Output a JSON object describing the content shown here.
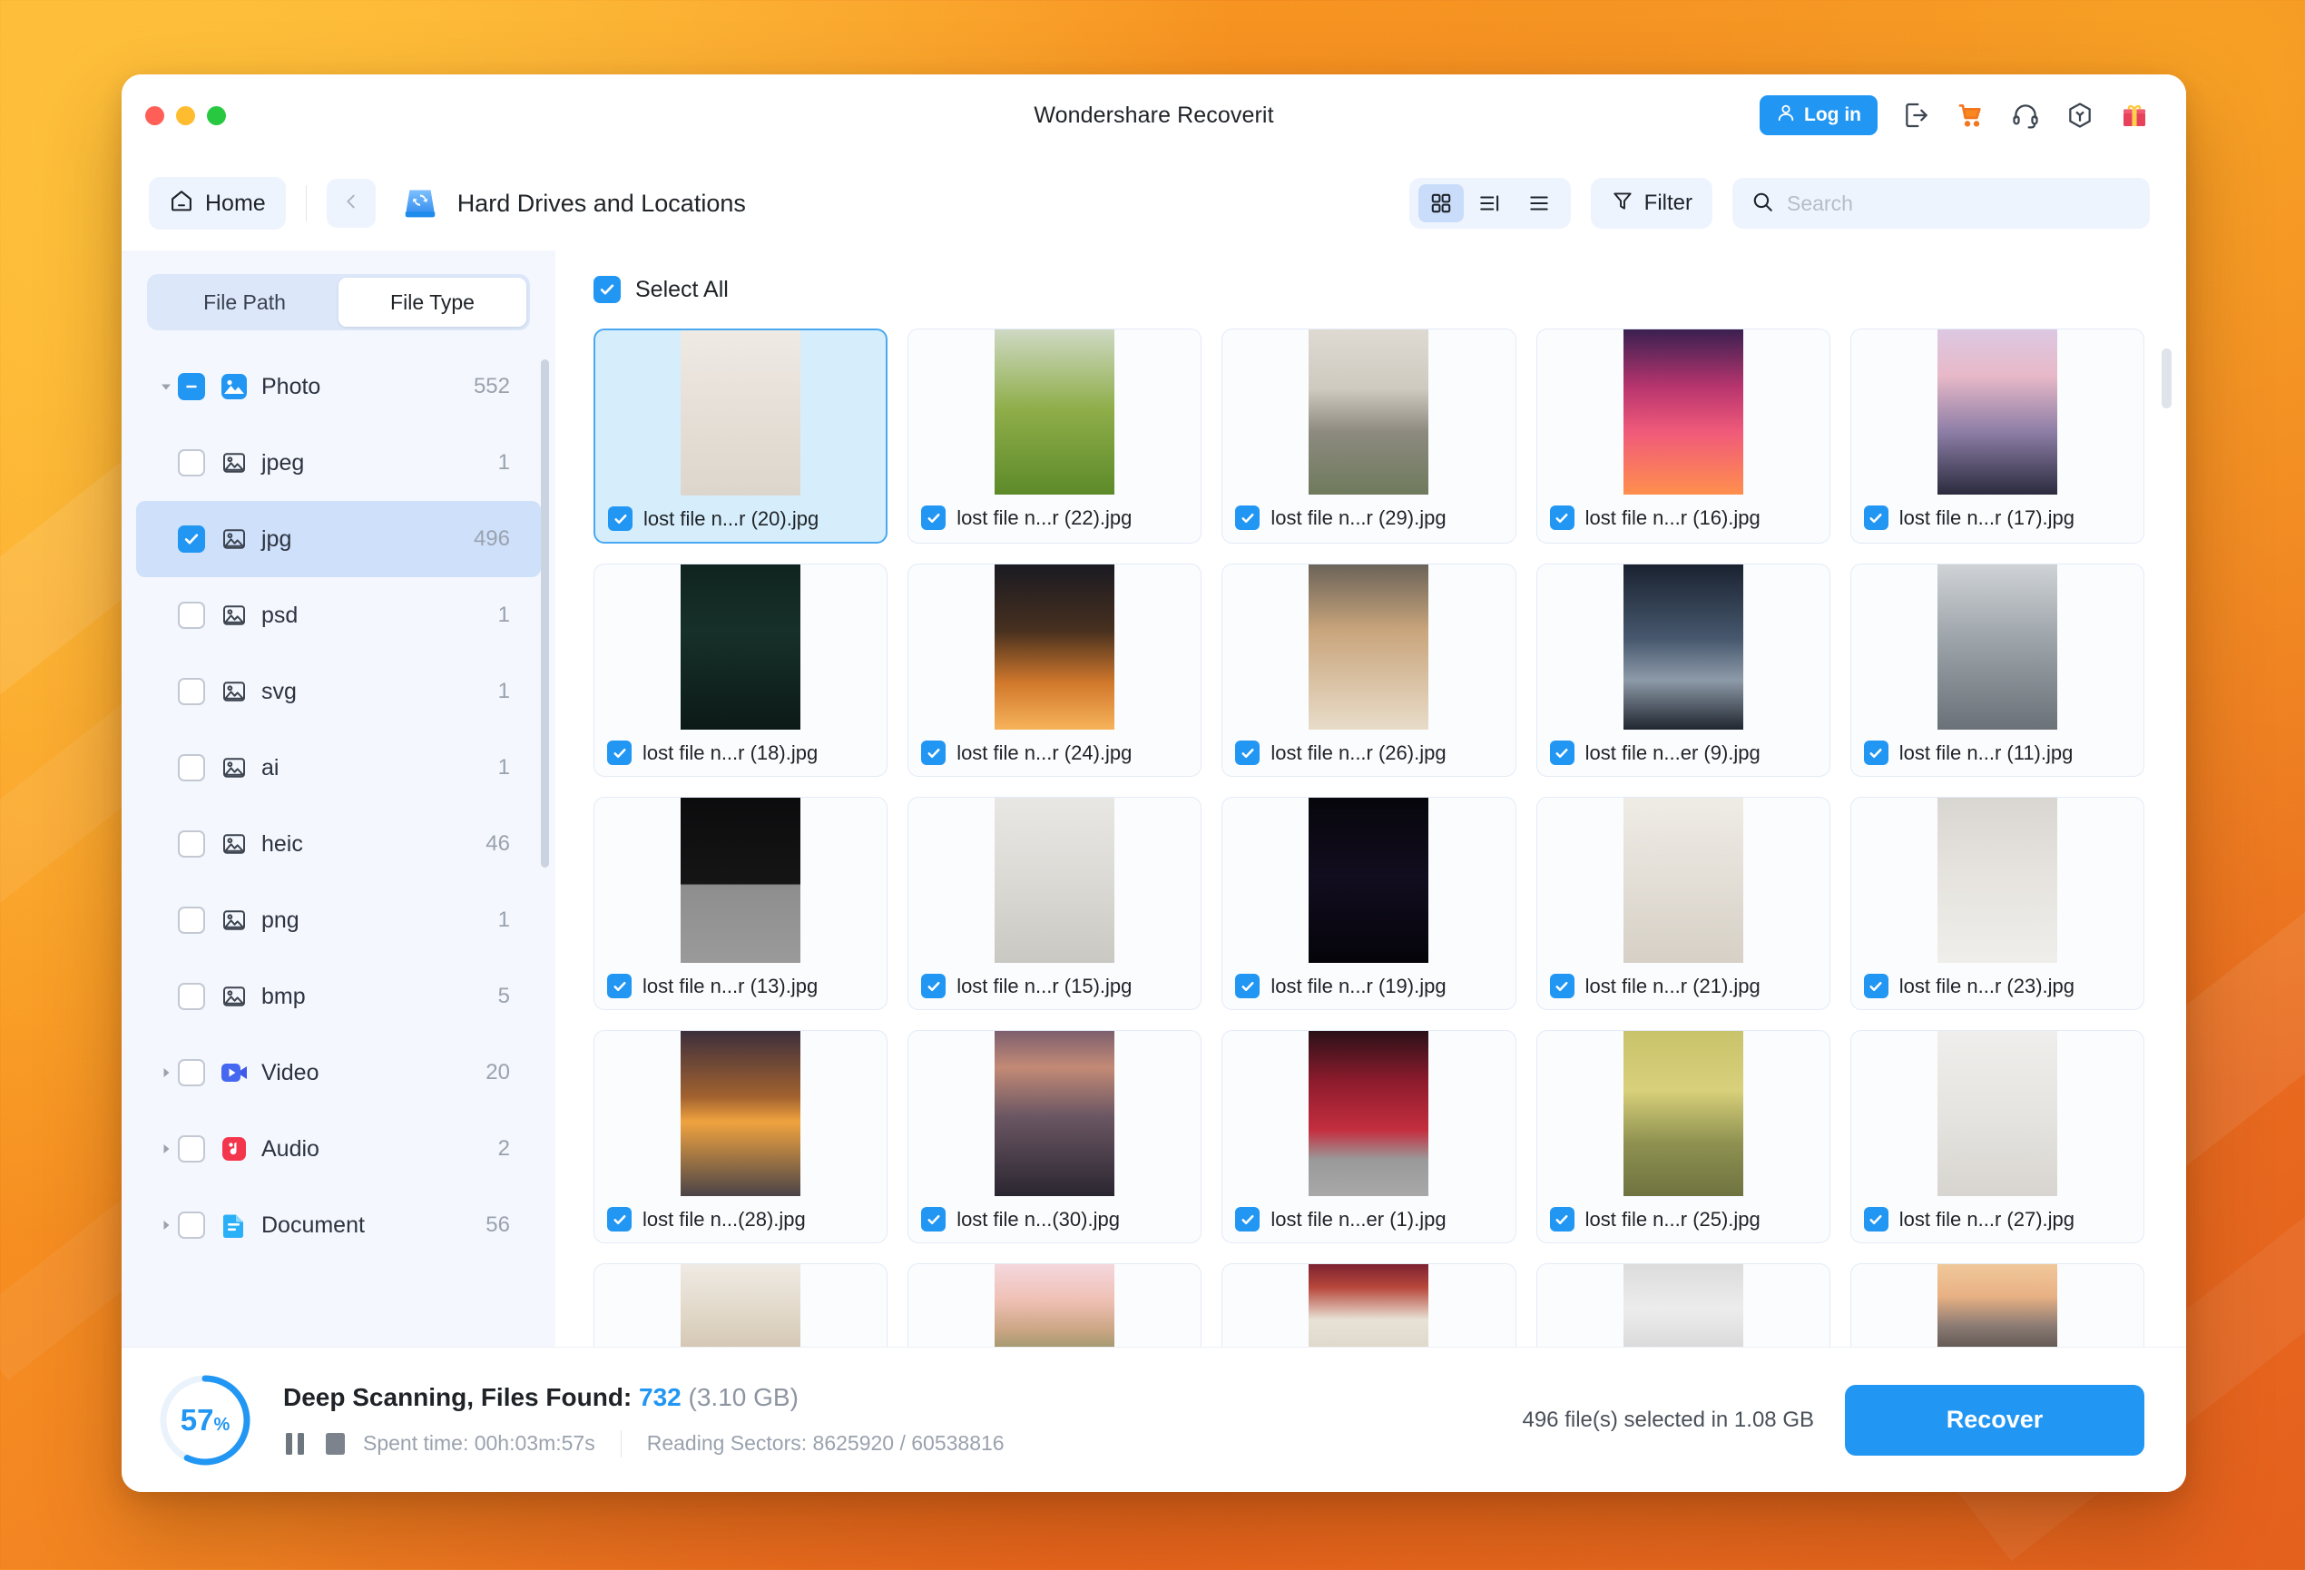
{
  "window": {
    "title": "Wondershare Recoverit",
    "traffic_lights": [
      "close",
      "minimize",
      "maximize"
    ]
  },
  "titlebar": {
    "login_label": "Log in",
    "icons": [
      "user-icon",
      "export-icon",
      "cart-icon",
      "headset-icon",
      "box-icon",
      "gift-icon"
    ]
  },
  "nav": {
    "home_label": "Home",
    "location_title": "Hard Drives and Locations",
    "back_icon": "chevron-left-icon",
    "view_modes": [
      {
        "name": "grid",
        "active": true
      },
      {
        "name": "split-list",
        "active": false
      },
      {
        "name": "list",
        "active": false
      }
    ],
    "filter_label": "Filter",
    "search_placeholder": "Search",
    "search_value": ""
  },
  "sidebar": {
    "tabs": [
      {
        "label": "File Path",
        "active": false
      },
      {
        "label": "File Type",
        "active": true
      }
    ],
    "tree": [
      {
        "label": "Photo",
        "count": "552",
        "check": "indeterminate",
        "icon": "photo-category-icon",
        "caret": "down",
        "level": 0,
        "selected": false
      },
      {
        "label": "jpeg",
        "count": "1",
        "check": "unchecked",
        "icon": "image-file-icon",
        "caret": "none",
        "level": 1,
        "selected": false
      },
      {
        "label": "jpg",
        "count": "496",
        "check": "checked",
        "icon": "image-file-icon",
        "caret": "none",
        "level": 1,
        "selected": true
      },
      {
        "label": "psd",
        "count": "1",
        "check": "unchecked",
        "icon": "image-file-icon",
        "caret": "none",
        "level": 1,
        "selected": false
      },
      {
        "label": "svg",
        "count": "1",
        "check": "unchecked",
        "icon": "image-file-icon",
        "caret": "none",
        "level": 1,
        "selected": false
      },
      {
        "label": "ai",
        "count": "1",
        "check": "unchecked",
        "icon": "image-file-icon",
        "caret": "none",
        "level": 1,
        "selected": false
      },
      {
        "label": "heic",
        "count": "46",
        "check": "unchecked",
        "icon": "image-file-icon",
        "caret": "none",
        "level": 1,
        "selected": false
      },
      {
        "label": "png",
        "count": "1",
        "check": "unchecked",
        "icon": "image-file-icon",
        "caret": "none",
        "level": 1,
        "selected": false
      },
      {
        "label": "bmp",
        "count": "5",
        "check": "unchecked",
        "icon": "image-file-icon",
        "caret": "none",
        "level": 1,
        "selected": false
      },
      {
        "label": "Video",
        "count": "20",
        "check": "unchecked",
        "icon": "video-category-icon",
        "caret": "right",
        "level": 0,
        "selected": false
      },
      {
        "label": "Audio",
        "count": "2",
        "check": "unchecked",
        "icon": "audio-category-icon",
        "caret": "right",
        "level": 0,
        "selected": false
      },
      {
        "label": "Document",
        "count": "56",
        "check": "unchecked",
        "icon": "document-category-icon",
        "caret": "right",
        "level": 0,
        "selected": false
      }
    ]
  },
  "content": {
    "select_all_label": "Select All",
    "select_all_checked": true,
    "files": [
      {
        "name": "lost file n...r (20).jpg",
        "checked": true,
        "selected": true,
        "thumb": "cat-window-calico"
      },
      {
        "name": "lost file n...r (22).jpg",
        "checked": true,
        "selected": false,
        "thumb": "cat-in-leaves"
      },
      {
        "name": "lost file n...r (29).jpg",
        "checked": true,
        "selected": false,
        "thumb": "window-flowers-wall"
      },
      {
        "name": "lost file n...r (16).jpg",
        "checked": true,
        "selected": false,
        "thumb": "neon-pink-interior"
      },
      {
        "name": "lost file n...r (17).jpg",
        "checked": true,
        "selected": false,
        "thumb": "lavender-sunset-field"
      },
      {
        "name": "lost file n...r (18).jpg",
        "checked": true,
        "selected": false,
        "thumb": "dark-forest-mist"
      },
      {
        "name": "lost file n...r (24).jpg",
        "checked": true,
        "selected": false,
        "thumb": "tree-sunset-orange"
      },
      {
        "name": "lost file n...r (26).jpg",
        "checked": true,
        "selected": false,
        "thumb": "calico-cat-portrait"
      },
      {
        "name": "lost file n...er (9).jpg",
        "checked": true,
        "selected": false,
        "thumb": "mountain-clouds-dark"
      },
      {
        "name": "lost file n...r (11).jpg",
        "checked": true,
        "selected": false,
        "thumb": "grey-cat-closeup"
      },
      {
        "name": "lost file n...r (13).jpg",
        "checked": true,
        "selected": false,
        "thumb": "sushi-plate-dark"
      },
      {
        "name": "lost file n...r (15).jpg",
        "checked": true,
        "selected": false,
        "thumb": "white-cat-hallway"
      },
      {
        "name": "lost file n...r (19).jpg",
        "checked": true,
        "selected": false,
        "thumb": "lightning-night"
      },
      {
        "name": "lost file n...r (21).jpg",
        "checked": true,
        "selected": false,
        "thumb": "calico-cat-curtain"
      },
      {
        "name": "lost file n...r (23).jpg",
        "checked": true,
        "selected": false,
        "thumb": "siamese-cat-rug"
      },
      {
        "name": "lost file n...(28).jpg",
        "checked": true,
        "selected": false,
        "thumb": "sunset-sea-horizon"
      },
      {
        "name": "lost file n...(30).jpg",
        "checked": true,
        "selected": false,
        "thumb": "dusk-beach-rocks"
      },
      {
        "name": "lost file n...er (1).jpg",
        "checked": true,
        "selected": false,
        "thumb": "raspberries-red"
      },
      {
        "name": "lost file n...r (25).jpg",
        "checked": true,
        "selected": false,
        "thumb": "cat-yellow-stairs"
      },
      {
        "name": "lost file n...r (27).jpg",
        "checked": true,
        "selected": false,
        "thumb": "dog-on-bed-white"
      },
      {
        "name": "",
        "checked": false,
        "selected": false,
        "thumb": "antelope-desert"
      },
      {
        "name": "",
        "checked": false,
        "selected": false,
        "thumb": "kites-beach-sunset"
      },
      {
        "name": "",
        "checked": false,
        "selected": false,
        "thumb": "bougainvillea-street"
      },
      {
        "name": "",
        "checked": false,
        "selected": false,
        "thumb": "white-fridge-room"
      },
      {
        "name": "",
        "checked": false,
        "selected": false,
        "thumb": "snow-cabin-mountains"
      }
    ]
  },
  "status": {
    "percent": "57",
    "percent_sign": "%",
    "progress_value": 57,
    "headline_prefix": "Deep Scanning, Files Found:",
    "files_found": "732",
    "files_size": "(3.10 GB)",
    "spent_time": "Spent time: 00h:03m:57s",
    "reading_sectors": "Reading Sectors: 8625920 / 60538816",
    "pause_icon": "pause-icon",
    "stop_icon": "stop-icon",
    "selection_info": "496 file(s) selected in 1.08 GB",
    "recover_label": "Recover"
  },
  "colors": {
    "accent": "#2196f3",
    "selected_tile_bg": "#d6eefc",
    "sidebar_bg": "#f4f7fd",
    "tab_bg": "#dce7fa"
  }
}
